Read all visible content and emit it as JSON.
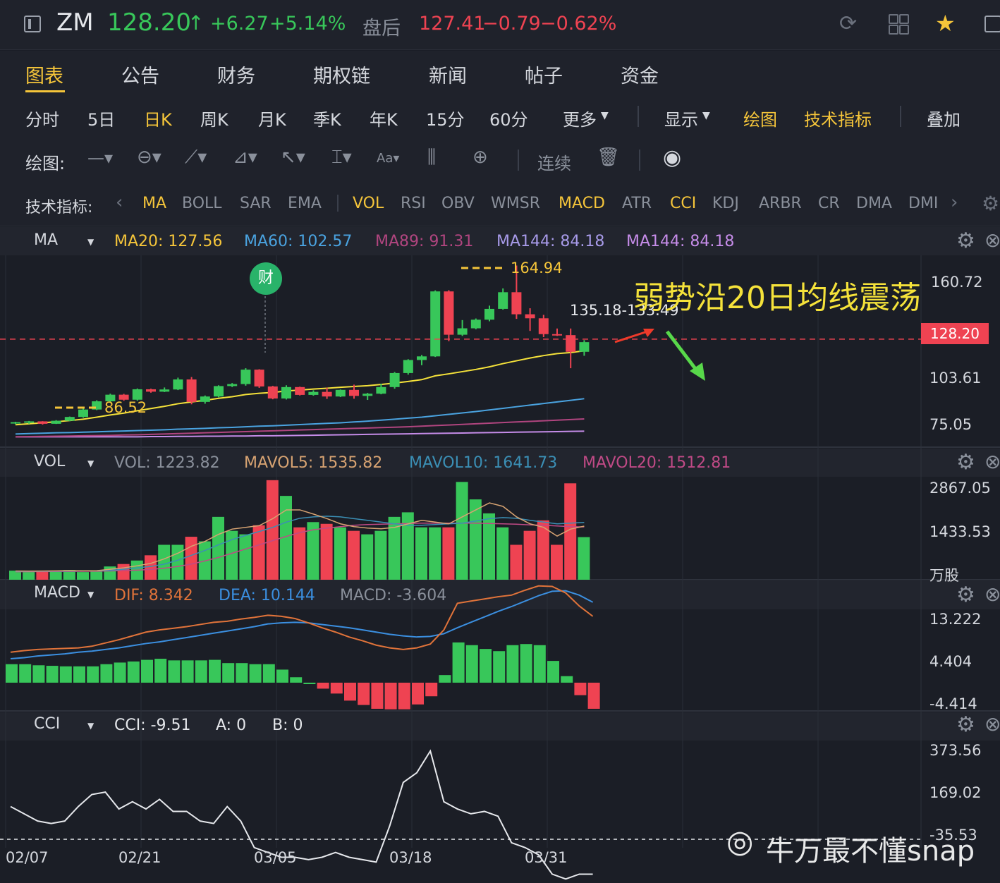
{
  "header": {
    "ticker": "ZM",
    "price": "128.20",
    "change": "+6.27",
    "change_pct": "+5.14%",
    "after_label": "盘后",
    "after_price": "127.41",
    "after_change": "−0.79",
    "after_pct": "−0.62%"
  },
  "tabs": [
    "图表",
    "公告",
    "财务",
    "期权链",
    "新闻",
    "帖子",
    "资金"
  ],
  "periods": [
    "分时",
    "5日",
    "日K",
    "周K",
    "月K",
    "季K",
    "年K",
    "15分",
    "60分",
    "更多"
  ],
  "period_active": "日K",
  "tools": {
    "display": "显示",
    "draw": "绘图",
    "indicator": "技术指标",
    "overlay": "叠加"
  },
  "drawbar": {
    "label": "绘图:",
    "continuous": "连续"
  },
  "indicator_bar": {
    "label": "技术指标:",
    "items": [
      "MA",
      "BOLL",
      "SAR",
      "EMA",
      "VOL",
      "RSI",
      "OBV",
      "WMSR",
      "MACD",
      "ATR",
      "CCI",
      "KDJ",
      "ARBR",
      "CR",
      "DMA",
      "DMI"
    ]
  },
  "ma_panel": {
    "name": "MA",
    "ma20": "MA20: 127.56",
    "ma60": "MA60: 102.57",
    "ma89": "MA89: 91.31",
    "ma144a": "MA144: 84.18",
    "ma144b": "MA144: 84.18",
    "axis": [
      "160.72",
      "128.20",
      "103.61",
      "75.05"
    ],
    "high_label": "164.94",
    "low_label": "86.52",
    "range_label": "135.18-133.49",
    "event_badge": "财",
    "annotation": "弱势沿20日均线震荡"
  },
  "vol_panel": {
    "name": "VOL",
    "vol": "VOL: 1223.82",
    "mavol5": "MAVOL5: 1535.82",
    "mavol10": "MAVOL10: 1641.73",
    "mavol20": "MAVOL20: 1512.81",
    "axis": [
      "2867.05",
      "1433.53",
      "万股"
    ]
  },
  "macd_panel": {
    "name": "MACD",
    "dif": "DIF: 8.342",
    "dea": "DEA: 10.144",
    "macd": "MACD: -3.604",
    "axis": [
      "13.222",
      "4.404",
      "-4.414"
    ]
  },
  "cci_panel": {
    "name": "CCI",
    "cci": "CCI: -9.51",
    "a": "A: 0",
    "b": "B: 0",
    "axis": [
      "373.56",
      "169.02",
      "-35.53"
    ]
  },
  "dates": [
    "02/07",
    "02/21",
    "03/05",
    "03/18",
    "03/31"
  ],
  "watermark": "牛万最不懂snap",
  "colors": {
    "up": "#38c75a",
    "down": "#ef4352",
    "accent": "#f5c53a",
    "bg": "#1b1e26"
  },
  "chart_data": {
    "type": "candlestick",
    "ohlc": [
      [
        86.5,
        87.0,
        85.8,
        86.8
      ],
      [
        86.8,
        87.4,
        86.0,
        87.2
      ],
      [
        87.2,
        87.3,
        85.6,
        86.0
      ],
      [
        86.0,
        87.8,
        85.9,
        87.5
      ],
      [
        87.5,
        89.6,
        87.3,
        89.4
      ],
      [
        89.4,
        93.6,
        89.0,
        93.1
      ],
      [
        93.1,
        97.7,
        92.8,
        97.2
      ],
      [
        97.2,
        101.0,
        96.9,
        100.5
      ],
      [
        100.5,
        100.9,
        97.5,
        98.0
      ],
      [
        98.0,
        103.6,
        97.5,
        103.2
      ],
      [
        103.2,
        103.5,
        101.5,
        102.0
      ],
      [
        102.0,
        104.1,
        101.8,
        103.1
      ],
      [
        103.1,
        109.0,
        102.8,
        108.1
      ],
      [
        108.1,
        109.3,
        95.7,
        96.9
      ],
      [
        96.9,
        100.1,
        96.0,
        99.6
      ],
      [
        99.6,
        105.2,
        99.2,
        104.8
      ],
      [
        104.8,
        106.3,
        104.3,
        105.8
      ],
      [
        105.8,
        113.7,
        105.0,
        113.0
      ],
      [
        113.0,
        113.2,
        103.9,
        104.6
      ],
      [
        104.6,
        104.9,
        98.2,
        98.6
      ],
      [
        98.6,
        105.2,
        98.1,
        104.3
      ],
      [
        104.3,
        104.5,
        100.1,
        100.4
      ],
      [
        100.4,
        102.7,
        100.0,
        101.9
      ],
      [
        101.9,
        104.0,
        98.4,
        99.6
      ],
      [
        99.6,
        103.1,
        99.3,
        102.9
      ],
      [
        102.9,
        105.5,
        98.5,
        99.9
      ],
      [
        99.9,
        101.4,
        97.9,
        101.0
      ],
      [
        101.0,
        106.0,
        100.7,
        104.3
      ],
      [
        104.3,
        111.8,
        103.5,
        111.3
      ],
      [
        111.3,
        118.2,
        110.5,
        117.8
      ],
      [
        117.8,
        120.3,
        115.2,
        119.6
      ],
      [
        119.6,
        152.5,
        119.3,
        152.0
      ],
      [
        152.0,
        152.6,
        127.2,
        130.4
      ],
      [
        130.4,
        137.7,
        129.8,
        133.6
      ],
      [
        133.6,
        138.5,
        133.1,
        137.9
      ],
      [
        137.9,
        144.9,
        137.1,
        143.3
      ],
      [
        143.3,
        153.5,
        142.9,
        151.6
      ],
      [
        151.6,
        164.9,
        138.3,
        140.6
      ],
      [
        140.6,
        143.6,
        132.3,
        138.6
      ],
      [
        138.6,
        140.3,
        129.2,
        130.7
      ],
      [
        130.7,
        133.5,
        129.8,
        130.2
      ],
      [
        130.2,
        133.5,
        113.7,
        121.9
      ],
      [
        121.9,
        127.7,
        119.9,
        126.7
      ]
    ],
    "ma20": [
      85.5,
      86.0,
      86.5,
      87.0,
      87.6,
      88.3,
      89.3,
      90.4,
      91.3,
      92.5,
      93.6,
      94.7,
      96.0,
      96.9,
      97.7,
      98.7,
      99.5,
      100.6,
      101.2,
      101.6,
      102.4,
      102.8,
      103.3,
      103.7,
      104.2,
      104.6,
      105.0,
      105.6,
      106.3,
      107.1,
      108.0,
      109.9,
      110.9,
      112.0,
      113.1,
      114.4,
      116.0,
      117.4,
      118.8,
      120.0,
      121.0,
      121.5,
      122.4
    ],
    "ma60": [
      80.9,
      81.1,
      81.3,
      81.5,
      81.6,
      81.8,
      82.0,
      82.2,
      82.4,
      82.6,
      82.8,
      83.0,
      83.3,
      83.5,
      83.7,
      84.0,
      84.2,
      84.5,
      84.8,
      85.0,
      85.3,
      85.6,
      85.9,
      86.2,
      86.5,
      86.9,
      87.3,
      87.8,
      88.3,
      88.8,
      89.3,
      90.0,
      90.7,
      91.4,
      92.1,
      92.9,
      93.7,
      94.5,
      95.3,
      96.1,
      96.9,
      97.7,
      98.5
    ],
    "ma89": [
      79.5,
      79.6,
      79.7,
      79.8,
      79.9,
      80.0,
      80.1,
      80.2,
      80.4,
      80.5,
      80.7,
      80.9,
      81.1,
      81.3,
      81.5,
      81.7,
      81.9,
      82.1,
      82.3,
      82.5,
      82.7,
      82.9,
      83.1,
      83.3,
      83.5,
      83.7,
      83.9,
      84.1,
      84.3,
      84.5,
      84.8,
      85.1,
      85.4,
      85.7,
      86.0,
      86.3,
      86.6,
      86.9,
      87.2,
      87.5,
      87.8,
      88.1,
      88.4
    ],
    "ma144": [
      79.5,
      79.5,
      79.5,
      79.5,
      79.5,
      79.5,
      79.5,
      79.5,
      79.5,
      79.5,
      79.6,
      79.6,
      79.7,
      79.7,
      79.8,
      79.8,
      79.9,
      79.9,
      80.0,
      80.0,
      80.1,
      80.2,
      80.3,
      80.4,
      80.5,
      80.6,
      80.7,
      80.8,
      80.9,
      81.0,
      81.1,
      81.2,
      81.3,
      81.4,
      81.5,
      81.6,
      81.7,
      81.8,
      81.9,
      82.0,
      82.1,
      82.2,
      82.3
    ],
    "volume": [
      260,
      250,
      230,
      240,
      280,
      220,
      260,
      380,
      450,
      550,
      700,
      1000,
      1000,
      1230,
      1100,
      1800,
      1400,
      1300,
      1560,
      2850,
      2400,
      1500,
      1650,
      1600,
      1500,
      1400,
      1300,
      1400,
      1800,
      1930,
      1500,
      1500,
      1500,
      2800,
      2300,
      1900,
      1500,
      1000,
      1400,
      1700,
      1000,
      2760,
      1220
    ],
    "mavol5": [
      250,
      248,
      250,
      255,
      262,
      255,
      260,
      300,
      340,
      400,
      470,
      600,
      760,
      960,
      1100,
      1300,
      1450,
      1500,
      1550,
      1750,
      2000,
      2000,
      1880,
      1750,
      1600,
      1520,
      1480,
      1460,
      1500,
      1600,
      1700,
      1650,
      1600,
      1800,
      2000,
      2200,
      2100,
      1800,
      1600,
      1500,
      1250,
      1450,
      1535
    ],
    "mavol10": [
      240,
      242,
      245,
      248,
      252,
      255,
      258,
      270,
      300,
      340,
      380,
      450,
      560,
      700,
      840,
      1000,
      1150,
      1270,
      1380,
      1500,
      1650,
      1760,
      1800,
      1820,
      1800,
      1750,
      1700,
      1650,
      1600,
      1560,
      1560,
      1580,
      1600,
      1620,
      1680,
      1750,
      1780,
      1760,
      1700,
      1650,
      1600,
      1620,
      1640
    ],
    "mavol20": [
      230,
      232,
      235,
      238,
      240,
      243,
      246,
      252,
      262,
      275,
      295,
      330,
      380,
      450,
      540,
      640,
      760,
      880,
      1000,
      1120,
      1240,
      1350,
      1430,
      1480,
      1520,
      1560,
      1580,
      1590,
      1600,
      1610,
      1620,
      1620,
      1620,
      1620,
      1620,
      1610,
      1600,
      1590,
      1570,
      1560,
      1540,
      1520,
      1512
    ],
    "dif": [
      5.6,
      5.9,
      6.1,
      6.2,
      6.3,
      6.4,
      6.7,
      7.3,
      7.9,
      8.6,
      9.3,
      9.7,
      10.0,
      10.3,
      10.7,
      11.1,
      11.3,
      11.7,
      12.0,
      12.4,
      12.2,
      11.8,
      11.0,
      10.1,
      9.3,
      8.4,
      7.7,
      6.9,
      6.4,
      6.1,
      6.4,
      7.1,
      9.7,
      14.6,
      15.0,
      15.4,
      15.8,
      16.1,
      17.0,
      17.8,
      17.7,
      16.5,
      14.1,
      12.2
    ],
    "dea": [
      4.4,
      4.6,
      4.9,
      5.1,
      5.3,
      5.6,
      5.8,
      6.1,
      6.4,
      6.8,
      7.2,
      7.5,
      7.9,
      8.3,
      8.7,
      9.1,
      9.5,
      9.9,
      10.3,
      10.8,
      11.0,
      11.1,
      11.0,
      10.7,
      10.4,
      10.1,
      9.7,
      9.3,
      8.9,
      8.6,
      8.4,
      8.5,
      9.0,
      10.1,
      11.1,
      12.1,
      13.1,
      14.0,
      15.0,
      16.0,
      16.8,
      16.9,
      16.1,
      14.8
    ],
    "macd": [
      3.4,
      3.4,
      3.2,
      3.1,
      3.0,
      3.0,
      3.0,
      3.4,
      3.7,
      3.9,
      4.2,
      4.4,
      4.1,
      4.1,
      4.1,
      4.2,
      3.6,
      3.6,
      3.4,
      3.4,
      2.4,
      1.0,
      0.0,
      -1.1,
      -2.0,
      -3.3,
      -4.1,
      -4.8,
      -4.9,
      -4.9,
      -4.0,
      -2.5,
      1.4,
      7.4,
      6.9,
      6.2,
      5.8,
      6.9,
      7.1,
      6.9,
      4.0,
      1.2,
      -2.3,
      -4.8
    ],
    "cci": [
      100,
      70,
      40,
      30,
      40,
      100,
      150,
      160,
      90,
      120,
      90,
      130,
      80,
      80,
      40,
      30,
      100,
      40,
      -70,
      -90,
      -110,
      -110,
      -120,
      -110,
      -90,
      -110,
      -120,
      -130,
      20,
      200,
      240,
      330,
      120,
      90,
      70,
      80,
      60,
      -50,
      -70,
      -100,
      -180,
      -200,
      -180,
      -180
    ],
    "ylim_price": [
      75.05,
      170.0
    ],
    "ylim_volume": [
      0,
      2867.05
    ],
    "ylim_macd": [
      -4.414,
      13.222
    ],
    "ylim_cci": [
      -35.53,
      373.56
    ]
  }
}
